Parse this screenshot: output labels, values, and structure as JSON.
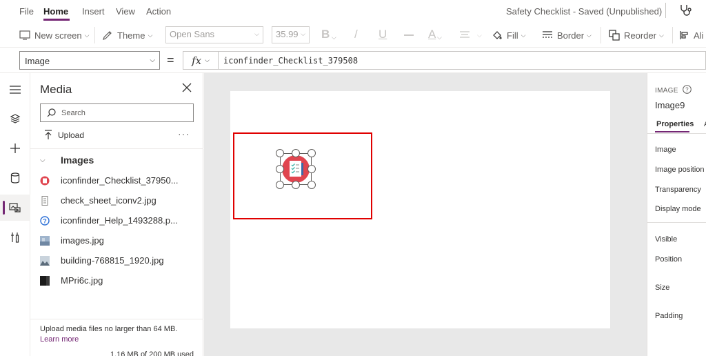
{
  "menu": {
    "items": [
      "File",
      "Home",
      "Insert",
      "View",
      "Action"
    ],
    "active": "Home"
  },
  "app": {
    "status_title": "Safety Checklist - Saved (Unpublished)"
  },
  "toolbar": {
    "new_screen": "New screen",
    "theme": "Theme",
    "font_family": "Open Sans",
    "font_size": "35.99",
    "bold": "B",
    "italic": "/",
    "underline": "U",
    "strike": "—",
    "font_color": "A",
    "fill": "Fill",
    "border": "Border",
    "reorder": "Reorder",
    "align": "Ali"
  },
  "formula": {
    "property": "Image",
    "equals": "=",
    "fx": "fx",
    "value": "iconfinder_Checklist_379508"
  },
  "media": {
    "title": "Media",
    "search_placeholder": "Search",
    "upload": "Upload",
    "more": "···",
    "section_title": "Images",
    "items": [
      {
        "name": "iconfinder_Checklist_37950...",
        "icon": "checklist-thumb-icon"
      },
      {
        "name": "check_sheet_iconv2.jpg",
        "icon": "file-thumb-icon"
      },
      {
        "name": "iconfinder_Help_1493288.p...",
        "icon": "help-thumb-icon"
      },
      {
        "name": "images.jpg",
        "icon": "photo-thumb-icon"
      },
      {
        "name": "building-768815_1920.jpg",
        "icon": "landscape-thumb-icon"
      },
      {
        "name": "MPri6c.jpg",
        "icon": "dark-thumb-icon"
      }
    ],
    "footer_note": "Upload media files no larger than 64 MB.",
    "footer_link": "Learn more",
    "usage": "1.16 MB of 200 MB used"
  },
  "properties": {
    "type_label": "IMAGE",
    "control_name": "Image9",
    "tab": "Properties",
    "tab_more": "A",
    "rows": [
      "Image",
      "Image position",
      "Transparency",
      "Display mode",
      "Visible",
      "Position",
      "Size",
      "Padding"
    ]
  },
  "colors": {
    "accent": "#742774",
    "selection": "#e00000",
    "icon_red": "#e0454f"
  }
}
